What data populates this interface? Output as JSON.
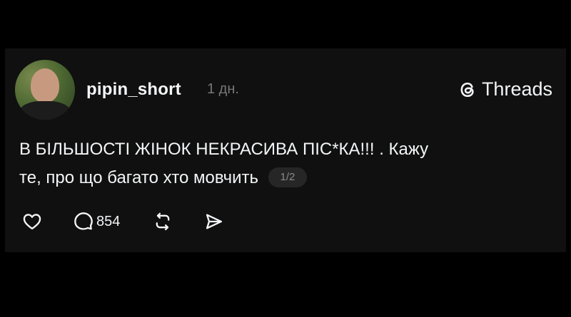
{
  "post": {
    "username": "pipin_short",
    "time": "1 дн.",
    "brand": "Threads",
    "text_line1": "В БІЛЬШОСТІ ЖІНОК НЕКРАСИВА ПІС*КА!!! . Кажу",
    "text_line2": "те, про що багато хто мовчить",
    "page_indicator": "1/2",
    "reply_count": "854"
  },
  "icons": {
    "brand": "threads-logo-icon",
    "like": "heart-icon",
    "reply": "comment-bubble-icon",
    "repost": "repost-icon",
    "share": "send-icon"
  },
  "colors": {
    "background": "#000000",
    "card": "#101010",
    "text": "#f3f5f7",
    "muted": "#777777"
  }
}
